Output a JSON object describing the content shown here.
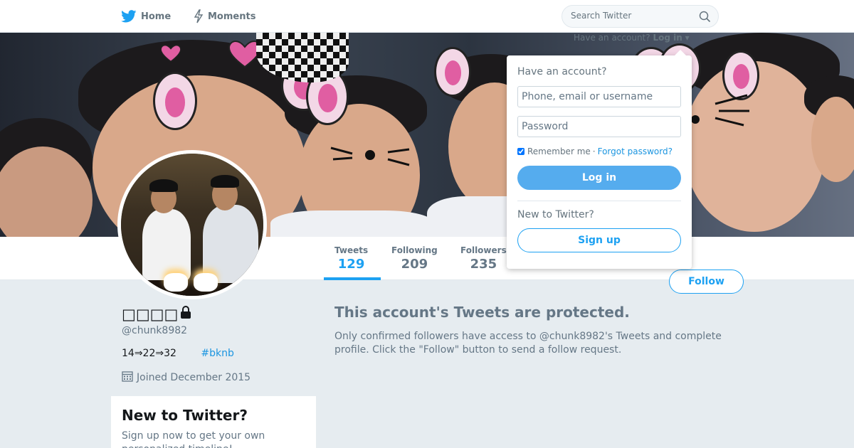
{
  "nav": {
    "home_label": "Home",
    "home_icon": "twitter-bird-icon",
    "moments_label": "Moments",
    "moments_icon": "lightning-icon",
    "search_placeholder": "Search Twitter",
    "search_icon": "search-icon"
  },
  "banner": {
    "have_account_text": "Have an account?",
    "login_toggle_label": "Log in"
  },
  "login_dropdown": {
    "heading": "Have an account?",
    "username_placeholder": "Phone, email or username",
    "password_placeholder": "Password",
    "remember_label": "Remember me",
    "separator": "·",
    "forgot_label": "Forgot password?",
    "login_button": "Log in",
    "new_heading": "New to Twitter?",
    "signup_button": "Sign up"
  },
  "stats": [
    {
      "label": "Tweets",
      "value": "129"
    },
    {
      "label": "Following",
      "value": "209"
    },
    {
      "label": "Followers",
      "value": "235"
    }
  ],
  "follow_button": "Follow",
  "profile": {
    "name": "□□□□",
    "lock_icon": "lock-icon",
    "handle": "@chunk8982",
    "bio_text": "14⇒22⇒32",
    "bio_hashtag": "#bknb",
    "joined_icon": "calendar-icon",
    "joined": "Joined December 2015"
  },
  "signup_box": {
    "title": "New to Twitter?",
    "text": "Sign up now to get your own personalized timeline!"
  },
  "protected": {
    "title": "This account's Tweets are protected.",
    "text": "Only confirmed followers have access to @chunk8982's Tweets and complete profile. Click the \"Follow\" button to send a follow request."
  },
  "colors": {
    "accent": "#1da1f2",
    "login_button_bg": "#55acee",
    "page_bg": "#e6ecf0",
    "muted_text": "#657786"
  }
}
